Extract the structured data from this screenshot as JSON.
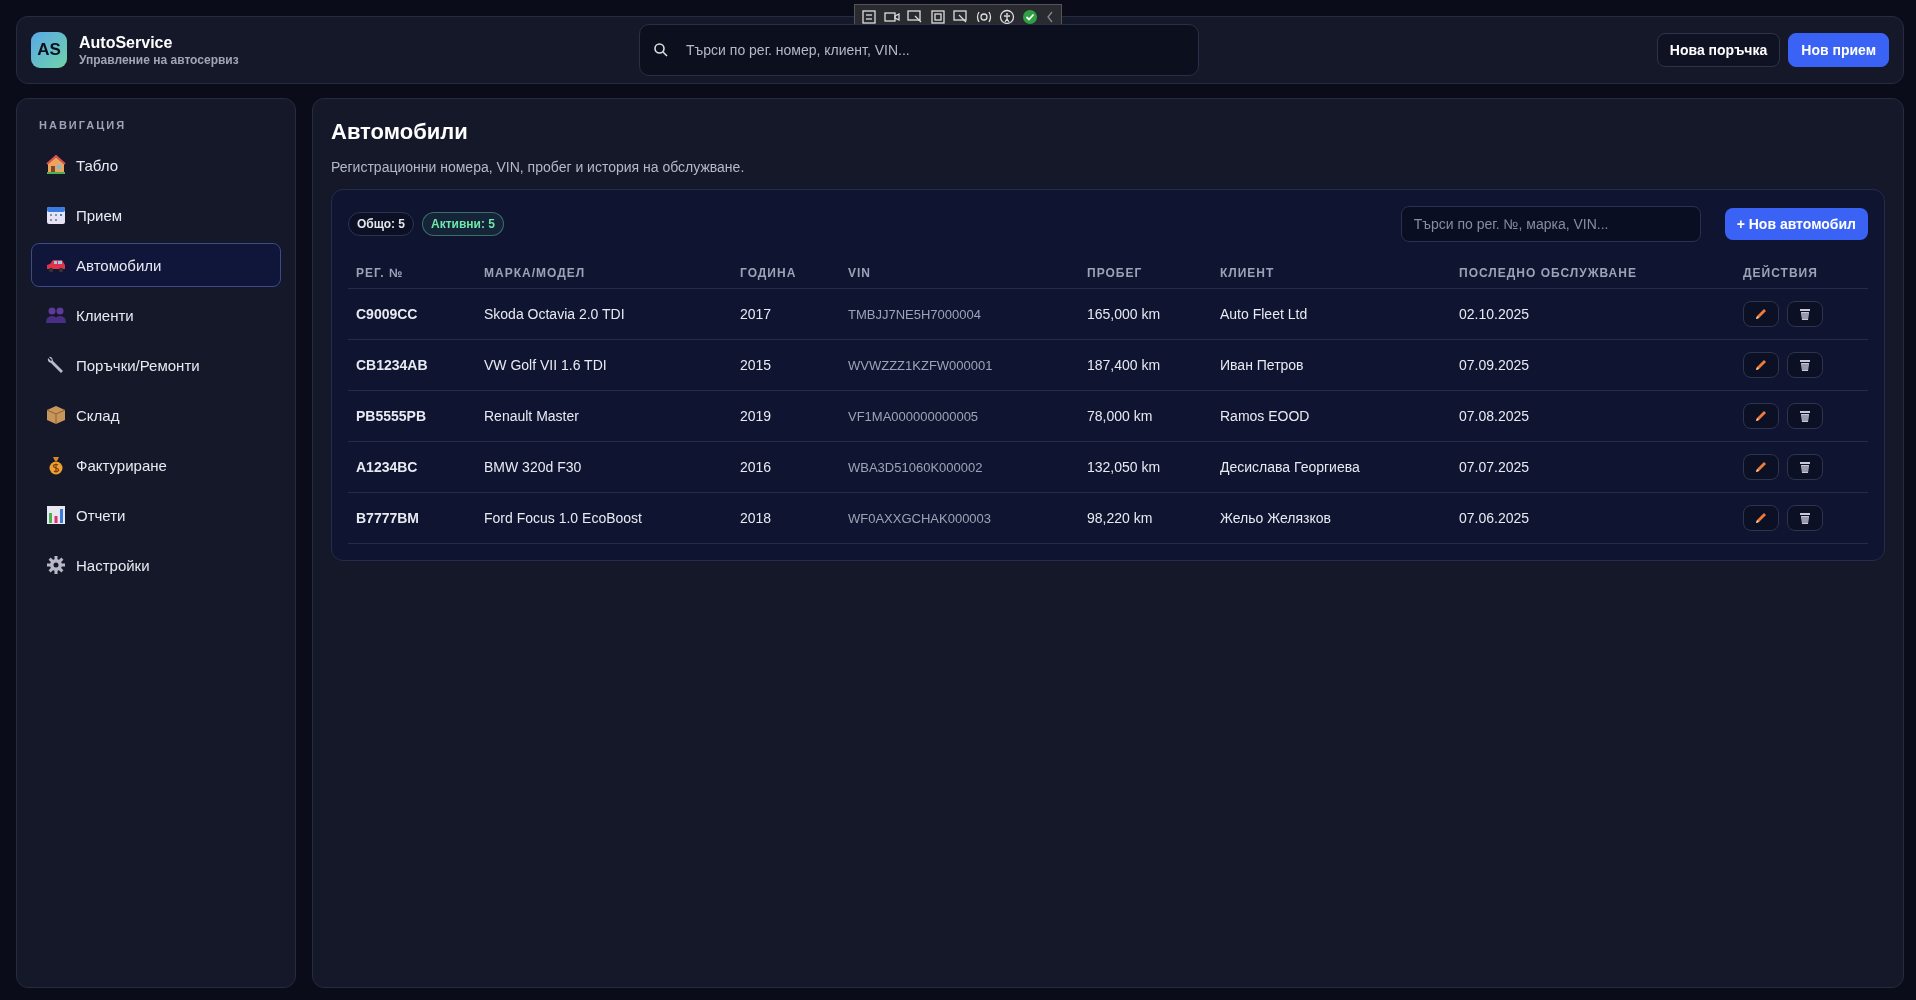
{
  "app": {
    "logo": "AS",
    "name": "AutoService",
    "tagline": "Управление на автосервиз"
  },
  "header_search": {
    "placeholder": "Търси по рег. номер, клиент, VIN..."
  },
  "header_buttons": [
    {
      "label": "Нова поръчка",
      "kind": "secondary"
    },
    {
      "label": "Нов прием",
      "kind": "primary"
    }
  ],
  "sidebar": {
    "heading": "НАВИГАЦИЯ",
    "items": [
      {
        "label": "Табло",
        "selected": false
      },
      {
        "label": "Прием",
        "selected": false
      },
      {
        "label": "Автомобили",
        "selected": true
      },
      {
        "label": "Клиенти",
        "selected": false
      },
      {
        "label": "Поръчки/Ремонти",
        "selected": false
      },
      {
        "label": "Склад",
        "selected": false
      },
      {
        "label": "Фактуриране",
        "selected": false
      },
      {
        "label": "Отчети",
        "selected": false
      },
      {
        "label": "Настройки",
        "selected": false
      }
    ]
  },
  "page": {
    "title": "Автомобили",
    "subtitle": "Регистрационни номера, VIN, пробег и история на обслужване."
  },
  "badges": [
    {
      "text": "Общо: 5",
      "color": "#e5e7eb"
    },
    {
      "text": "Активни: 5",
      "color": "#6ee7a8"
    }
  ],
  "table_search": {
    "placeholder": "Търси по рег. №, марка, VIN..."
  },
  "add_button": {
    "label": "+ Нов автомобил"
  },
  "table": {
    "columns": [
      "РЕГ. №",
      "МАРКА/МОДЕЛ",
      "ГОДИНА",
      "VIN",
      "ПРОБЕГ",
      "КЛИЕНТ",
      "ПОСЛЕДНО ОБСЛУЖВАНЕ",
      "ДЕЙСТВИЯ"
    ],
    "rows": [
      [
        "C9009CC",
        "Skoda Octavia 2.0 TDI",
        "2017",
        "TMBJJ7NE5H7000004",
        "165,000 km",
        "Auto Fleet Ltd",
        "02.10.2025"
      ],
      [
        "CB1234AB",
        "VW Golf VII 1.6 TDI",
        "2015",
        "WVWZZZ1KZFW000001",
        "187,400 km",
        "Иван Петров",
        "07.09.2025"
      ],
      [
        "PB5555PB",
        "Renault Master",
        "2019",
        "VF1MA000000000005",
        "78,000 km",
        "Ramos EOOD",
        "07.08.2025"
      ],
      [
        "A1234BC",
        "BMW 320d F30",
        "2016",
        "WBA3D51060K000002",
        "132,050 km",
        "Десислава Георгиева",
        "07.07.2025"
      ],
      [
        "B7777BM",
        "Ford Focus 1.0 EcoBoost",
        "2018",
        "WF0AXXGCHAK000003",
        "98,220 km",
        "Жельо Желязков",
        "07.06.2025"
      ]
    ]
  }
}
